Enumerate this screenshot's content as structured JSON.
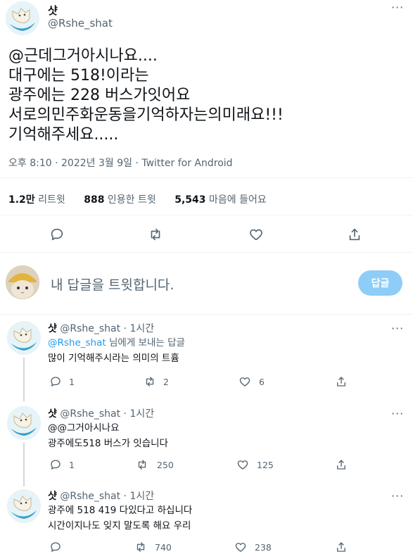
{
  "main_tweet": {
    "author_name": "샷",
    "author_handle": "@Rshe_shat",
    "text_lines": [
      "@근데그거아시나요....",
      "대구에는 518!이라는",
      "광주에는 228 버스가잇어요",
      "서로의민주화운동을기억하자는의미래요!!!",
      "기억해주세요....."
    ],
    "meta": "오후 8:10 · 2022년 3월 9일 · Twitter for Android",
    "stats": {
      "retweets_count": "1.2만",
      "retweets_label": "리트윗",
      "quotes_count": "888",
      "quotes_label": "인용한 트윗",
      "likes_count": "5,543",
      "likes_label": "마음에 들어요"
    }
  },
  "reply_box": {
    "placeholder": "내 답글을 트윗합니다.",
    "button_label": "답글"
  },
  "replies": [
    {
      "author_name": "샷",
      "handle_time": "@Rshe_shat · 1시간",
      "replying_to": "@Rshe_shat",
      "replying_suffix": " 님에게 보내는 답글",
      "lines": [
        "많이 기억해주시라는 의미의 트흄"
      ],
      "reply_count": "1",
      "retweet_count": "2",
      "like_count": "6"
    },
    {
      "author_name": "샷",
      "handle_time": "@Rshe_shat · 1시간",
      "lines": [
        "@@그거아시나요",
        "광주에도518 버스가 잇습니다"
      ],
      "reply_count": "1",
      "retweet_count": "250",
      "like_count": "125"
    },
    {
      "author_name": "샷",
      "handle_time": "@Rshe_shat · 1시간",
      "lines": [
        "광주에 518 419 다있다고 하십니다",
        "시간이지나도 잊지 말도록 해요 우리"
      ],
      "reply_count": "",
      "retweet_count": "740",
      "like_count": "238"
    }
  ],
  "icons": {
    "more": "more-dots-icon",
    "reply": "reply-icon",
    "retweet": "retweet-icon",
    "like": "like-icon",
    "share": "share-icon"
  },
  "colors": {
    "accent": "#1d9bf0",
    "reply_button_disabled": "#8ecdf8",
    "text_secondary": "#536471"
  }
}
